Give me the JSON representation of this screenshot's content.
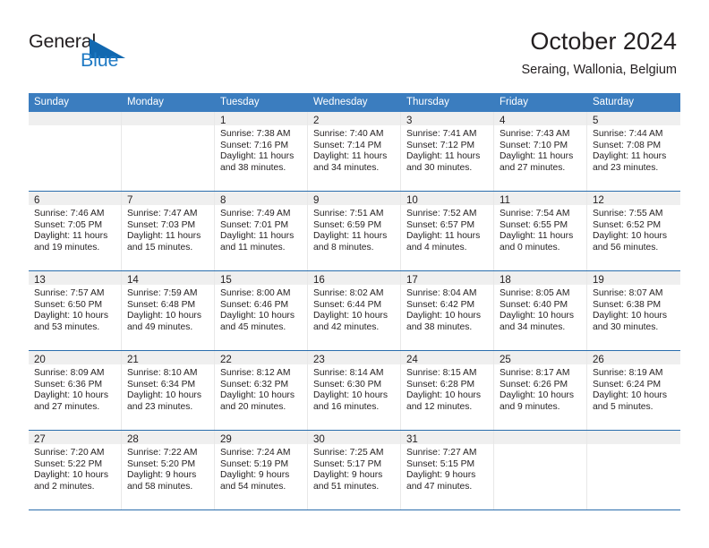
{
  "logo": {
    "text_primary": "General",
    "text_secondary": "Blue",
    "icon": "triangle-icon",
    "color_primary": "#231f20",
    "color_secondary": "#1f7ac4"
  },
  "header": {
    "title": "October 2024",
    "subtitle": "Seraing, Wallonia, Belgium"
  },
  "theme": {
    "header_bar": "#3b7dbf",
    "row_divider": "#2a6ead",
    "date_band": "#efefef",
    "text": "#231f20"
  },
  "weekdays": [
    "Sunday",
    "Monday",
    "Tuesday",
    "Wednesday",
    "Thursday",
    "Friday",
    "Saturday"
  ],
  "weeks": [
    [
      {
        "empty": true
      },
      {
        "empty": true
      },
      {
        "day": "1",
        "sunrise": "Sunrise: 7:38 AM",
        "sunset": "Sunset: 7:16 PM",
        "daylight": "Daylight: 11 hours and 38 minutes."
      },
      {
        "day": "2",
        "sunrise": "Sunrise: 7:40 AM",
        "sunset": "Sunset: 7:14 PM",
        "daylight": "Daylight: 11 hours and 34 minutes."
      },
      {
        "day": "3",
        "sunrise": "Sunrise: 7:41 AM",
        "sunset": "Sunset: 7:12 PM",
        "daylight": "Daylight: 11 hours and 30 minutes."
      },
      {
        "day": "4",
        "sunrise": "Sunrise: 7:43 AM",
        "sunset": "Sunset: 7:10 PM",
        "daylight": "Daylight: 11 hours and 27 minutes."
      },
      {
        "day": "5",
        "sunrise": "Sunrise: 7:44 AM",
        "sunset": "Sunset: 7:08 PM",
        "daylight": "Daylight: 11 hours and 23 minutes."
      }
    ],
    [
      {
        "day": "6",
        "sunrise": "Sunrise: 7:46 AM",
        "sunset": "Sunset: 7:05 PM",
        "daylight": "Daylight: 11 hours and 19 minutes."
      },
      {
        "day": "7",
        "sunrise": "Sunrise: 7:47 AM",
        "sunset": "Sunset: 7:03 PM",
        "daylight": "Daylight: 11 hours and 15 minutes."
      },
      {
        "day": "8",
        "sunrise": "Sunrise: 7:49 AM",
        "sunset": "Sunset: 7:01 PM",
        "daylight": "Daylight: 11 hours and 11 minutes."
      },
      {
        "day": "9",
        "sunrise": "Sunrise: 7:51 AM",
        "sunset": "Sunset: 6:59 PM",
        "daylight": "Daylight: 11 hours and 8 minutes."
      },
      {
        "day": "10",
        "sunrise": "Sunrise: 7:52 AM",
        "sunset": "Sunset: 6:57 PM",
        "daylight": "Daylight: 11 hours and 4 minutes."
      },
      {
        "day": "11",
        "sunrise": "Sunrise: 7:54 AM",
        "sunset": "Sunset: 6:55 PM",
        "daylight": "Daylight: 11 hours and 0 minutes."
      },
      {
        "day": "12",
        "sunrise": "Sunrise: 7:55 AM",
        "sunset": "Sunset: 6:52 PM",
        "daylight": "Daylight: 10 hours and 56 minutes."
      }
    ],
    [
      {
        "day": "13",
        "sunrise": "Sunrise: 7:57 AM",
        "sunset": "Sunset: 6:50 PM",
        "daylight": "Daylight: 10 hours and 53 minutes."
      },
      {
        "day": "14",
        "sunrise": "Sunrise: 7:59 AM",
        "sunset": "Sunset: 6:48 PM",
        "daylight": "Daylight: 10 hours and 49 minutes."
      },
      {
        "day": "15",
        "sunrise": "Sunrise: 8:00 AM",
        "sunset": "Sunset: 6:46 PM",
        "daylight": "Daylight: 10 hours and 45 minutes."
      },
      {
        "day": "16",
        "sunrise": "Sunrise: 8:02 AM",
        "sunset": "Sunset: 6:44 PM",
        "daylight": "Daylight: 10 hours and 42 minutes."
      },
      {
        "day": "17",
        "sunrise": "Sunrise: 8:04 AM",
        "sunset": "Sunset: 6:42 PM",
        "daylight": "Daylight: 10 hours and 38 minutes."
      },
      {
        "day": "18",
        "sunrise": "Sunrise: 8:05 AM",
        "sunset": "Sunset: 6:40 PM",
        "daylight": "Daylight: 10 hours and 34 minutes."
      },
      {
        "day": "19",
        "sunrise": "Sunrise: 8:07 AM",
        "sunset": "Sunset: 6:38 PM",
        "daylight": "Daylight: 10 hours and 30 minutes."
      }
    ],
    [
      {
        "day": "20",
        "sunrise": "Sunrise: 8:09 AM",
        "sunset": "Sunset: 6:36 PM",
        "daylight": "Daylight: 10 hours and 27 minutes."
      },
      {
        "day": "21",
        "sunrise": "Sunrise: 8:10 AM",
        "sunset": "Sunset: 6:34 PM",
        "daylight": "Daylight: 10 hours and 23 minutes."
      },
      {
        "day": "22",
        "sunrise": "Sunrise: 8:12 AM",
        "sunset": "Sunset: 6:32 PM",
        "daylight": "Daylight: 10 hours and 20 minutes."
      },
      {
        "day": "23",
        "sunrise": "Sunrise: 8:14 AM",
        "sunset": "Sunset: 6:30 PM",
        "daylight": "Daylight: 10 hours and 16 minutes."
      },
      {
        "day": "24",
        "sunrise": "Sunrise: 8:15 AM",
        "sunset": "Sunset: 6:28 PM",
        "daylight": "Daylight: 10 hours and 12 minutes."
      },
      {
        "day": "25",
        "sunrise": "Sunrise: 8:17 AM",
        "sunset": "Sunset: 6:26 PM",
        "daylight": "Daylight: 10 hours and 9 minutes."
      },
      {
        "day": "26",
        "sunrise": "Sunrise: 8:19 AM",
        "sunset": "Sunset: 6:24 PM",
        "daylight": "Daylight: 10 hours and 5 minutes."
      }
    ],
    [
      {
        "day": "27",
        "sunrise": "Sunrise: 7:20 AM",
        "sunset": "Sunset: 5:22 PM",
        "daylight": "Daylight: 10 hours and 2 minutes."
      },
      {
        "day": "28",
        "sunrise": "Sunrise: 7:22 AM",
        "sunset": "Sunset: 5:20 PM",
        "daylight": "Daylight: 9 hours and 58 minutes."
      },
      {
        "day": "29",
        "sunrise": "Sunrise: 7:24 AM",
        "sunset": "Sunset: 5:19 PM",
        "daylight": "Daylight: 9 hours and 54 minutes."
      },
      {
        "day": "30",
        "sunrise": "Sunrise: 7:25 AM",
        "sunset": "Sunset: 5:17 PM",
        "daylight": "Daylight: 9 hours and 51 minutes."
      },
      {
        "day": "31",
        "sunrise": "Sunrise: 7:27 AM",
        "sunset": "Sunset: 5:15 PM",
        "daylight": "Daylight: 9 hours and 47 minutes."
      },
      {
        "empty": true
      },
      {
        "empty": true
      }
    ]
  ]
}
